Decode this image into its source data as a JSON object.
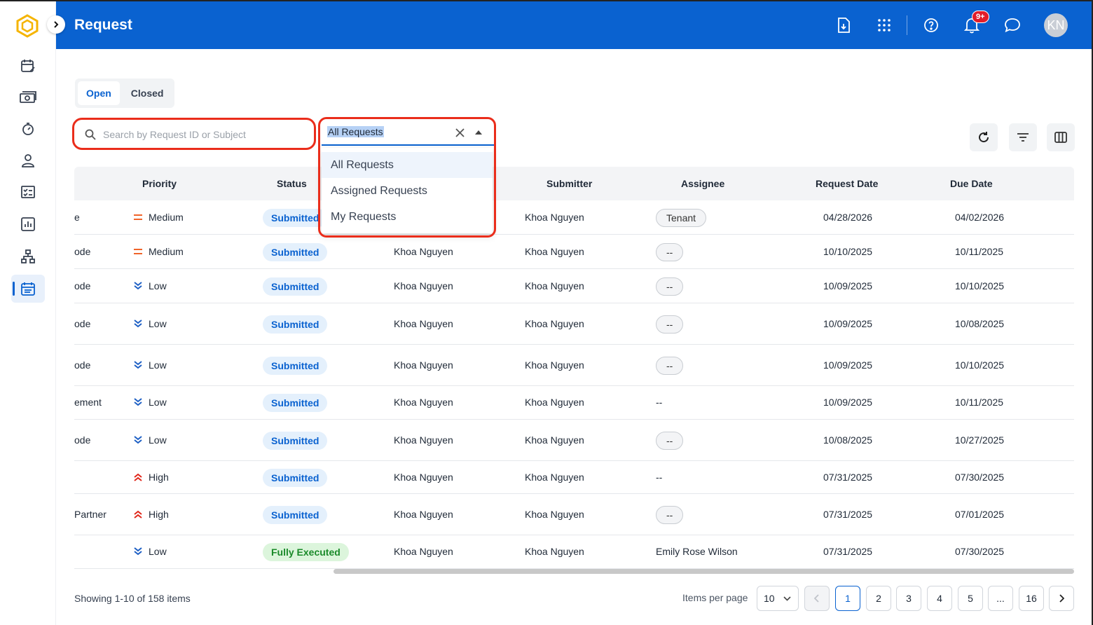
{
  "header": {
    "title": "Request",
    "notification_badge": "9+",
    "avatar_initials": "KN"
  },
  "tabs": [
    {
      "label": "Open",
      "active": true
    },
    {
      "label": "Closed",
      "active": false
    }
  ],
  "search": {
    "placeholder": "Search by Request ID or Subject",
    "value": ""
  },
  "filter_select": {
    "value": "All Requests",
    "options": [
      "All Requests",
      "Assigned Requests",
      "My Requests"
    ]
  },
  "table": {
    "columns": [
      "Priority",
      "Status",
      "Submitter",
      "Assignee",
      "Request Date",
      "Due Date"
    ],
    "rows": [
      {
        "subject": "e",
        "priority": "Medium",
        "status": "Submitted",
        "owner": "",
        "submitter": "Khoa Nguyen",
        "assignee": "Tenant",
        "request_date": "04/28/2026",
        "due_date": "04/02/2026"
      },
      {
        "subject": "ode",
        "priority": "Medium",
        "status": "Submitted",
        "owner": "Khoa Nguyen",
        "submitter": "Khoa Nguyen",
        "assignee": "--",
        "request_date": "10/10/2025",
        "due_date": "10/11/2025"
      },
      {
        "subject": "ode",
        "priority": "Low",
        "status": "Submitted",
        "owner": "Khoa Nguyen",
        "submitter": "Khoa Nguyen",
        "assignee": "--",
        "request_date": "10/09/2025",
        "due_date": "10/10/2025"
      },
      {
        "subject": "ode",
        "priority": "Low",
        "status": "Submitted",
        "owner": "Khoa Nguyen",
        "submitter": "Khoa Nguyen",
        "assignee": "--",
        "request_date": "10/09/2025",
        "due_date": "10/08/2025"
      },
      {
        "subject": "ode",
        "priority": "Low",
        "status": "Submitted",
        "owner": "Khoa Nguyen",
        "submitter": "Khoa Nguyen",
        "assignee": "--",
        "request_date": "10/09/2025",
        "due_date": "10/10/2025"
      },
      {
        "subject": "ement",
        "priority": "Low",
        "status": "Submitted",
        "owner": "Khoa Nguyen",
        "submitter": "Khoa Nguyen",
        "assignee": "--",
        "request_date": "10/09/2025",
        "due_date": "10/11/2025"
      },
      {
        "subject": "ode",
        "priority": "Low",
        "status": "Submitted",
        "owner": "Khoa Nguyen",
        "submitter": "Khoa Nguyen",
        "assignee": "--",
        "request_date": "10/08/2025",
        "due_date": "10/27/2025"
      },
      {
        "subject": "",
        "priority": "High",
        "status": "Submitted",
        "owner": "Khoa Nguyen",
        "submitter": "Khoa Nguyen",
        "assignee": "--",
        "request_date": "07/31/2025",
        "due_date": "07/30/2025"
      },
      {
        "subject": "Partner",
        "priority": "High",
        "status": "Submitted",
        "owner": "Khoa Nguyen",
        "submitter": "Khoa Nguyen",
        "assignee": "--",
        "request_date": "07/31/2025",
        "due_date": "07/01/2025"
      },
      {
        "subject": "",
        "priority": "Low",
        "status": "Fully Executed",
        "owner": "Khoa Nguyen",
        "submitter": "Khoa Nguyen",
        "assignee": "Emily Rose Wilson",
        "request_date": "07/31/2025",
        "due_date": "07/30/2025"
      }
    ]
  },
  "footer": {
    "showing": "Showing 1-10 of 158 items",
    "items_per_page_label": "Items per page",
    "items_per_page": "10",
    "pages": [
      "1",
      "2",
      "3",
      "4",
      "5",
      "...",
      "16"
    ]
  },
  "colors": {
    "brand": "#0a62d0",
    "highlight": "#ea2d1b"
  }
}
